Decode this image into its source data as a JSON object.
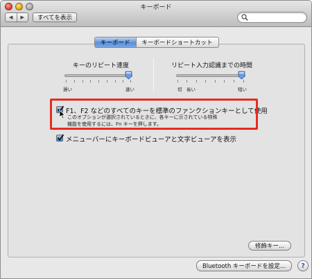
{
  "window": {
    "title": "キーボード"
  },
  "toolbar": {
    "back_glyph": "◀",
    "forward_glyph": "▶",
    "show_all_label": "すべてを表示",
    "search": {
      "value": "",
      "placeholder": ""
    }
  },
  "tabs": [
    {
      "label": "キーボード",
      "active": true
    },
    {
      "label": "キーボードショートカット",
      "active": false
    }
  ],
  "key_repeat": {
    "label": "キーのリピート速度",
    "min_label": "遅い",
    "max_label": "速い",
    "level": 1.0
  },
  "delay_until_repeat": {
    "label": "リピート入力認識までの時間",
    "off_label": "切",
    "long_label": "長い",
    "short_label": "短い",
    "level": 1.0
  },
  "fn_keys_option": {
    "checked": true,
    "label": "F1、F2 などのすべてのキーを標準のファンクションキーとして使用",
    "description_line1": "このオプションが選択されているときに、各キーに示されている特殊",
    "description_line2": "機能を使用するには、Fn キーを押します。"
  },
  "keyboard_viewer_option": {
    "checked": true,
    "label": "メニューバーにキーボードビューアと文字ビューアを表示"
  },
  "buttons": {
    "modifier_keys": "修飾キー...",
    "bluetooth_setup": "Bluetooth キーボードを設定...",
    "help": "?"
  },
  "colors": {
    "highlight": "#e42c20",
    "accent": "#3f7fd6"
  },
  "icons": {
    "search": "magnifier-icon",
    "checkmark": "checkmark-icon",
    "pointer": "arrow-pointer-icon"
  }
}
